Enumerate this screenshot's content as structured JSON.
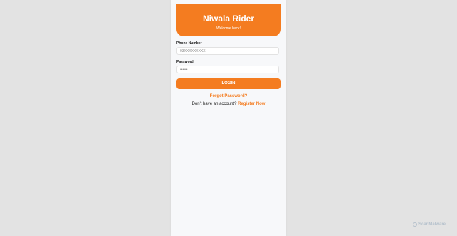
{
  "header": {
    "title": "Niwala Rider",
    "subtitle": "Welcome back!"
  },
  "form": {
    "phone_label": "Phone Number",
    "phone_placeholder": "03XXXXXXXXX",
    "password_label": "Password",
    "password_placeholder": "••••••",
    "login_label": "LOGIN"
  },
  "links": {
    "forgot": "Forgot Password?",
    "no_account": "Don't have an account?",
    "register": "Register Now"
  },
  "watermark": {
    "text": "ScanMalware",
    "icon": "shield-icon"
  },
  "colors": {
    "accent": "#f47c20",
    "background": "#e3e3e3",
    "card": "#f7f8fa"
  }
}
